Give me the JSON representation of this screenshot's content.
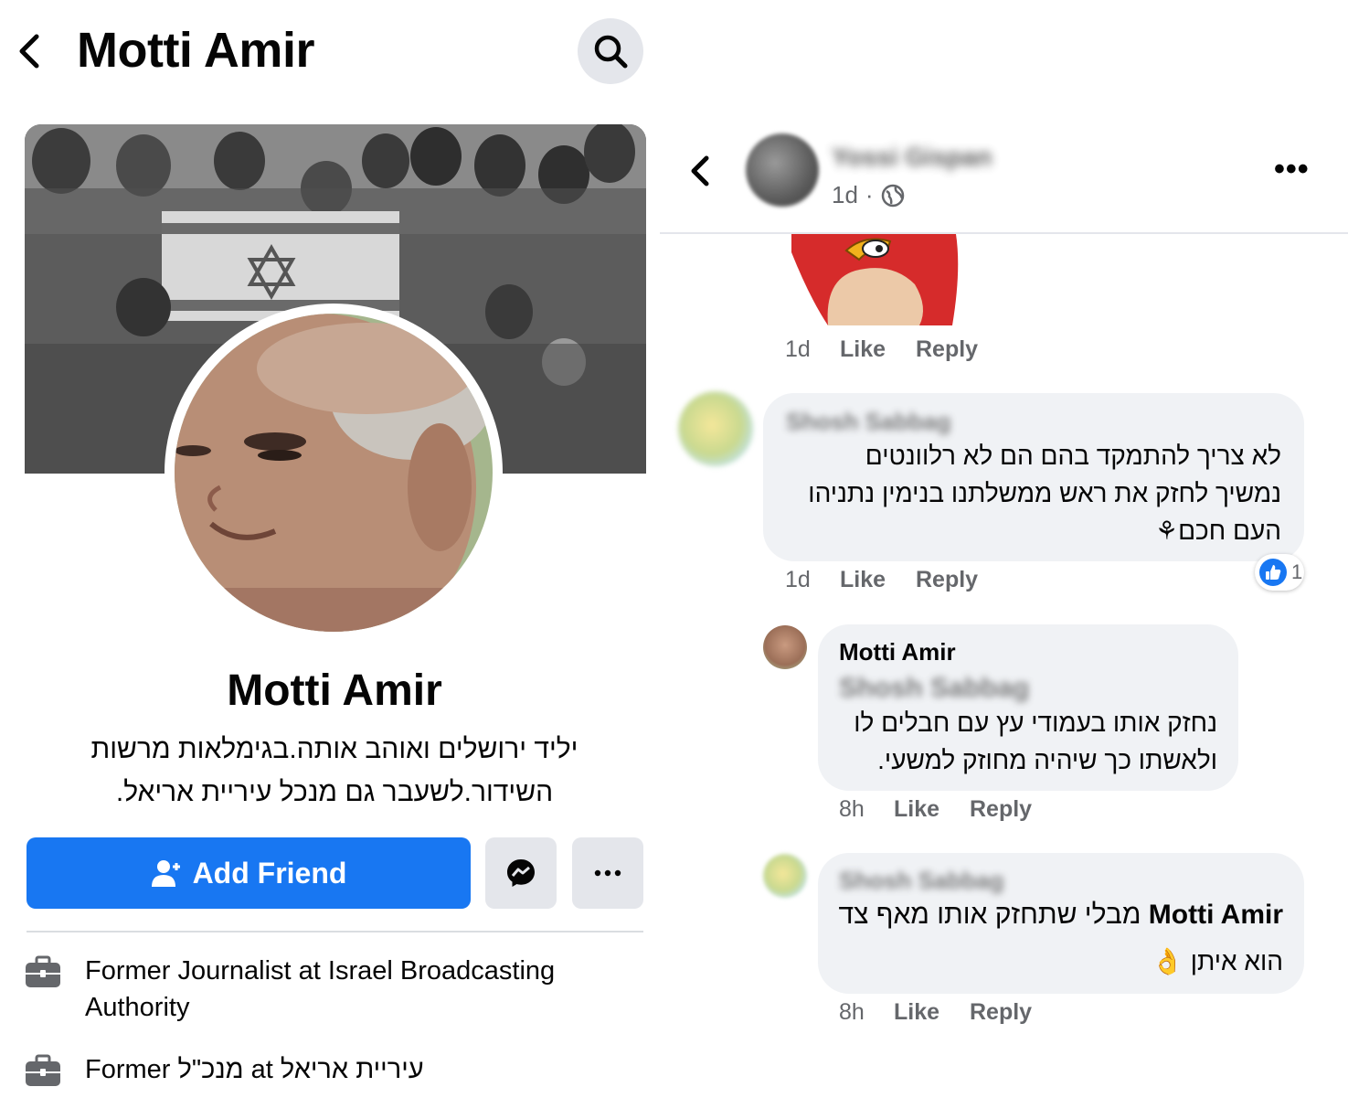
{
  "profile": {
    "header_title": "Motti Amir",
    "name": "Motti Amir",
    "bio_line1": "יליד ירושלים ואוהב אותה.בגימלאות מרשות",
    "bio_line2": "השידור.לשעבר גם מנכל עיריית אריאל.",
    "add_friend_label": "Add Friend",
    "work": [
      {
        "line1": "Former Journalist at Israel Broadcasting",
        "line2": "Authority"
      },
      {
        "line1": "Former מנכ\"ל at עיריית אריאל"
      }
    ]
  },
  "post": {
    "author": "Yossi Gispan",
    "time": "1d",
    "privacy_icon": "globe-icon",
    "more_label": "•••"
  },
  "comments": [
    {
      "author": "",
      "text_lines": [],
      "time": "1d",
      "like": "Like",
      "reply": "Reply"
    },
    {
      "author": "Shosh Sabbag",
      "text_lines": [
        "לא צריך להתמקד בהם הם לא רלוונטים",
        "נמשיך לחזק את ראש ממשלתנו בנימין נתניהו",
        "העם חכם⚘"
      ],
      "reaction_count": "1",
      "time": "1d",
      "like": "Like",
      "reply": "Reply"
    },
    {
      "author": "Motti Amir",
      "mention": "Shosh Sabbag",
      "text_lines": [
        "נחזק אותו בעמודי עץ עם חבלים לו",
        "ולאשתו כך שיהיה מחוזק למשעי."
      ],
      "time": "8h",
      "like": "Like",
      "reply": "Reply"
    },
    {
      "author": "Shosh Sabbag",
      "mention": "Motti Amir",
      "text_line1_rest": "מבלי שתחזק אותו מאף צד",
      "text_line2": "הוא איתן 👌",
      "time": "8h",
      "like": "Like",
      "reply": "Reply"
    }
  ],
  "colors": {
    "primary": "#1877f2",
    "secondary_bg": "#e4e6eb",
    "bubble_bg": "#f0f2f5",
    "muted_text": "#65676b"
  }
}
